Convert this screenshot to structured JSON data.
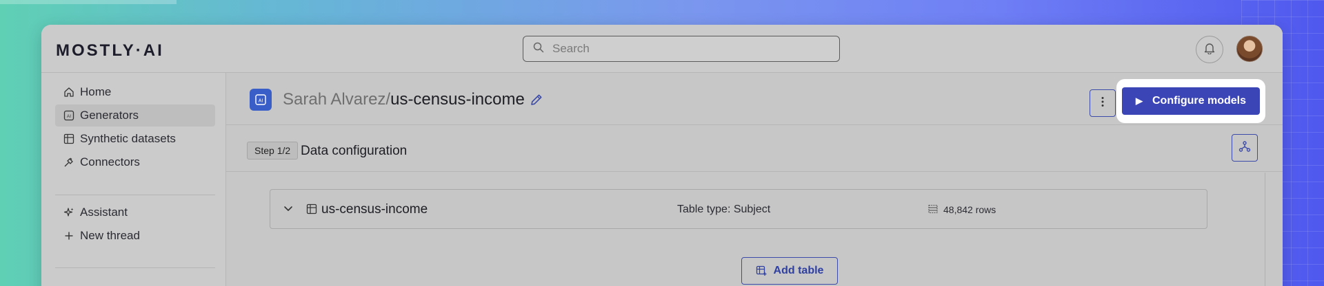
{
  "app": {
    "logo": "MOSTLY·AI"
  },
  "search": {
    "placeholder": "Search"
  },
  "sidebar": {
    "items": [
      {
        "label": "Home",
        "icon": "home-icon"
      },
      {
        "label": "Generators",
        "icon": "generator-icon",
        "active": true
      },
      {
        "label": "Synthetic datasets",
        "icon": "dataset-icon"
      },
      {
        "label": "Connectors",
        "icon": "plug-icon"
      }
    ],
    "assistant_items": [
      {
        "label": "Assistant",
        "icon": "sparkle-icon"
      },
      {
        "label": "New thread",
        "icon": "plus-icon"
      }
    ]
  },
  "header": {
    "owner": "Sarah Alvarez/",
    "generator_name": "us-census-income",
    "configure_label": "Configure models"
  },
  "step": {
    "badge": "Step 1/2",
    "title": "Data configuration"
  },
  "table": {
    "name": "us-census-income",
    "type_label": "Table type: Subject",
    "rows_label": "48,842 rows"
  },
  "actions": {
    "add_table_label": "Add table"
  },
  "colors": {
    "accent": "#3c45b6",
    "generator_badge": "#3a5ec8",
    "overlay": "#c8c8c8"
  }
}
